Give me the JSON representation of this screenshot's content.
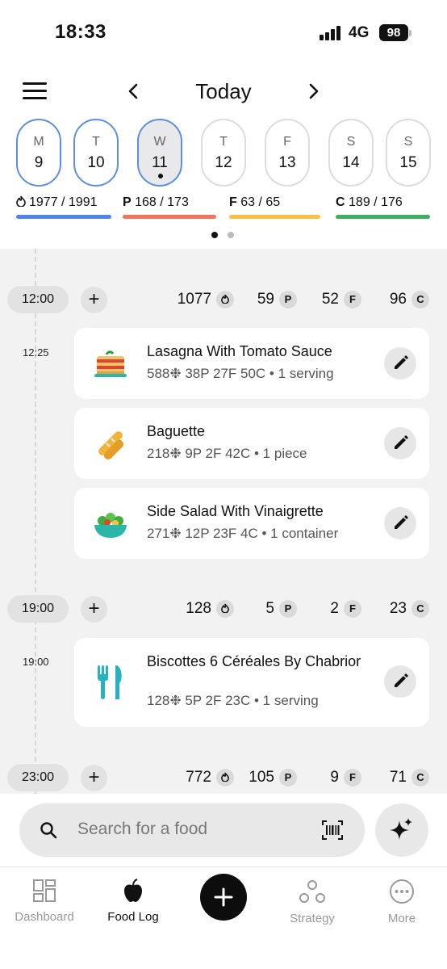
{
  "status": {
    "time": "18:33",
    "network": "4G",
    "battery": "98"
  },
  "header": {
    "title": "Today"
  },
  "days": [
    {
      "letter": "M",
      "num": "9"
    },
    {
      "letter": "T",
      "num": "10"
    },
    {
      "letter": "W",
      "num": "11"
    },
    {
      "letter": "T",
      "num": "12"
    },
    {
      "letter": "F",
      "num": "13"
    },
    {
      "letter": "S",
      "num": "14"
    },
    {
      "letter": "S",
      "num": "15"
    }
  ],
  "summary": {
    "calories": {
      "text": "1977 / 1991",
      "color": "#4f86e3"
    },
    "protein": {
      "prefix": "P",
      "text": "168 / 173",
      "color": "#f0755a"
    },
    "fat": {
      "prefix": "F",
      "text": "63 / 65",
      "color": "#f5c242"
    },
    "carbs": {
      "prefix": "C",
      "text": "189 / 176",
      "color": "#3fae62"
    }
  },
  "slots": [
    {
      "time": "12:00",
      "calories": "1077",
      "protein": "59",
      "fat": "52",
      "carbs": "96",
      "entry_time": "12:25",
      "foods": [
        {
          "name": "Lasagna With Tomato Sauce",
          "meta": "588❉ 38P 27F 50C • 1 serving"
        },
        {
          "name": "Baguette",
          "meta": "218❉ 9P 2F 42C • 1 piece"
        },
        {
          "name": "Side Salad With Vinaigrette",
          "meta": "271❉ 12P 23F 4C • 1 container"
        }
      ]
    },
    {
      "time": "19:00",
      "calories": "128",
      "protein": "5",
      "fat": "2",
      "carbs": "23",
      "entry_time": "19:00",
      "foods": [
        {
          "name": "Biscottes 6 Céréales By Chabrior",
          "meta": "128❉ 5P 2F 23C • 1 serving"
        }
      ]
    },
    {
      "time": "23:00",
      "calories": "772",
      "protein": "105",
      "fat": "9",
      "carbs": "71"
    }
  ],
  "badges": {
    "protein": "P",
    "fat": "F",
    "carbs": "C"
  },
  "search": {
    "placeholder": "Search for a food"
  },
  "tabs": {
    "dashboard": "Dashboard",
    "food_log": "Food Log",
    "strategy": "Strategy",
    "more": "More"
  }
}
